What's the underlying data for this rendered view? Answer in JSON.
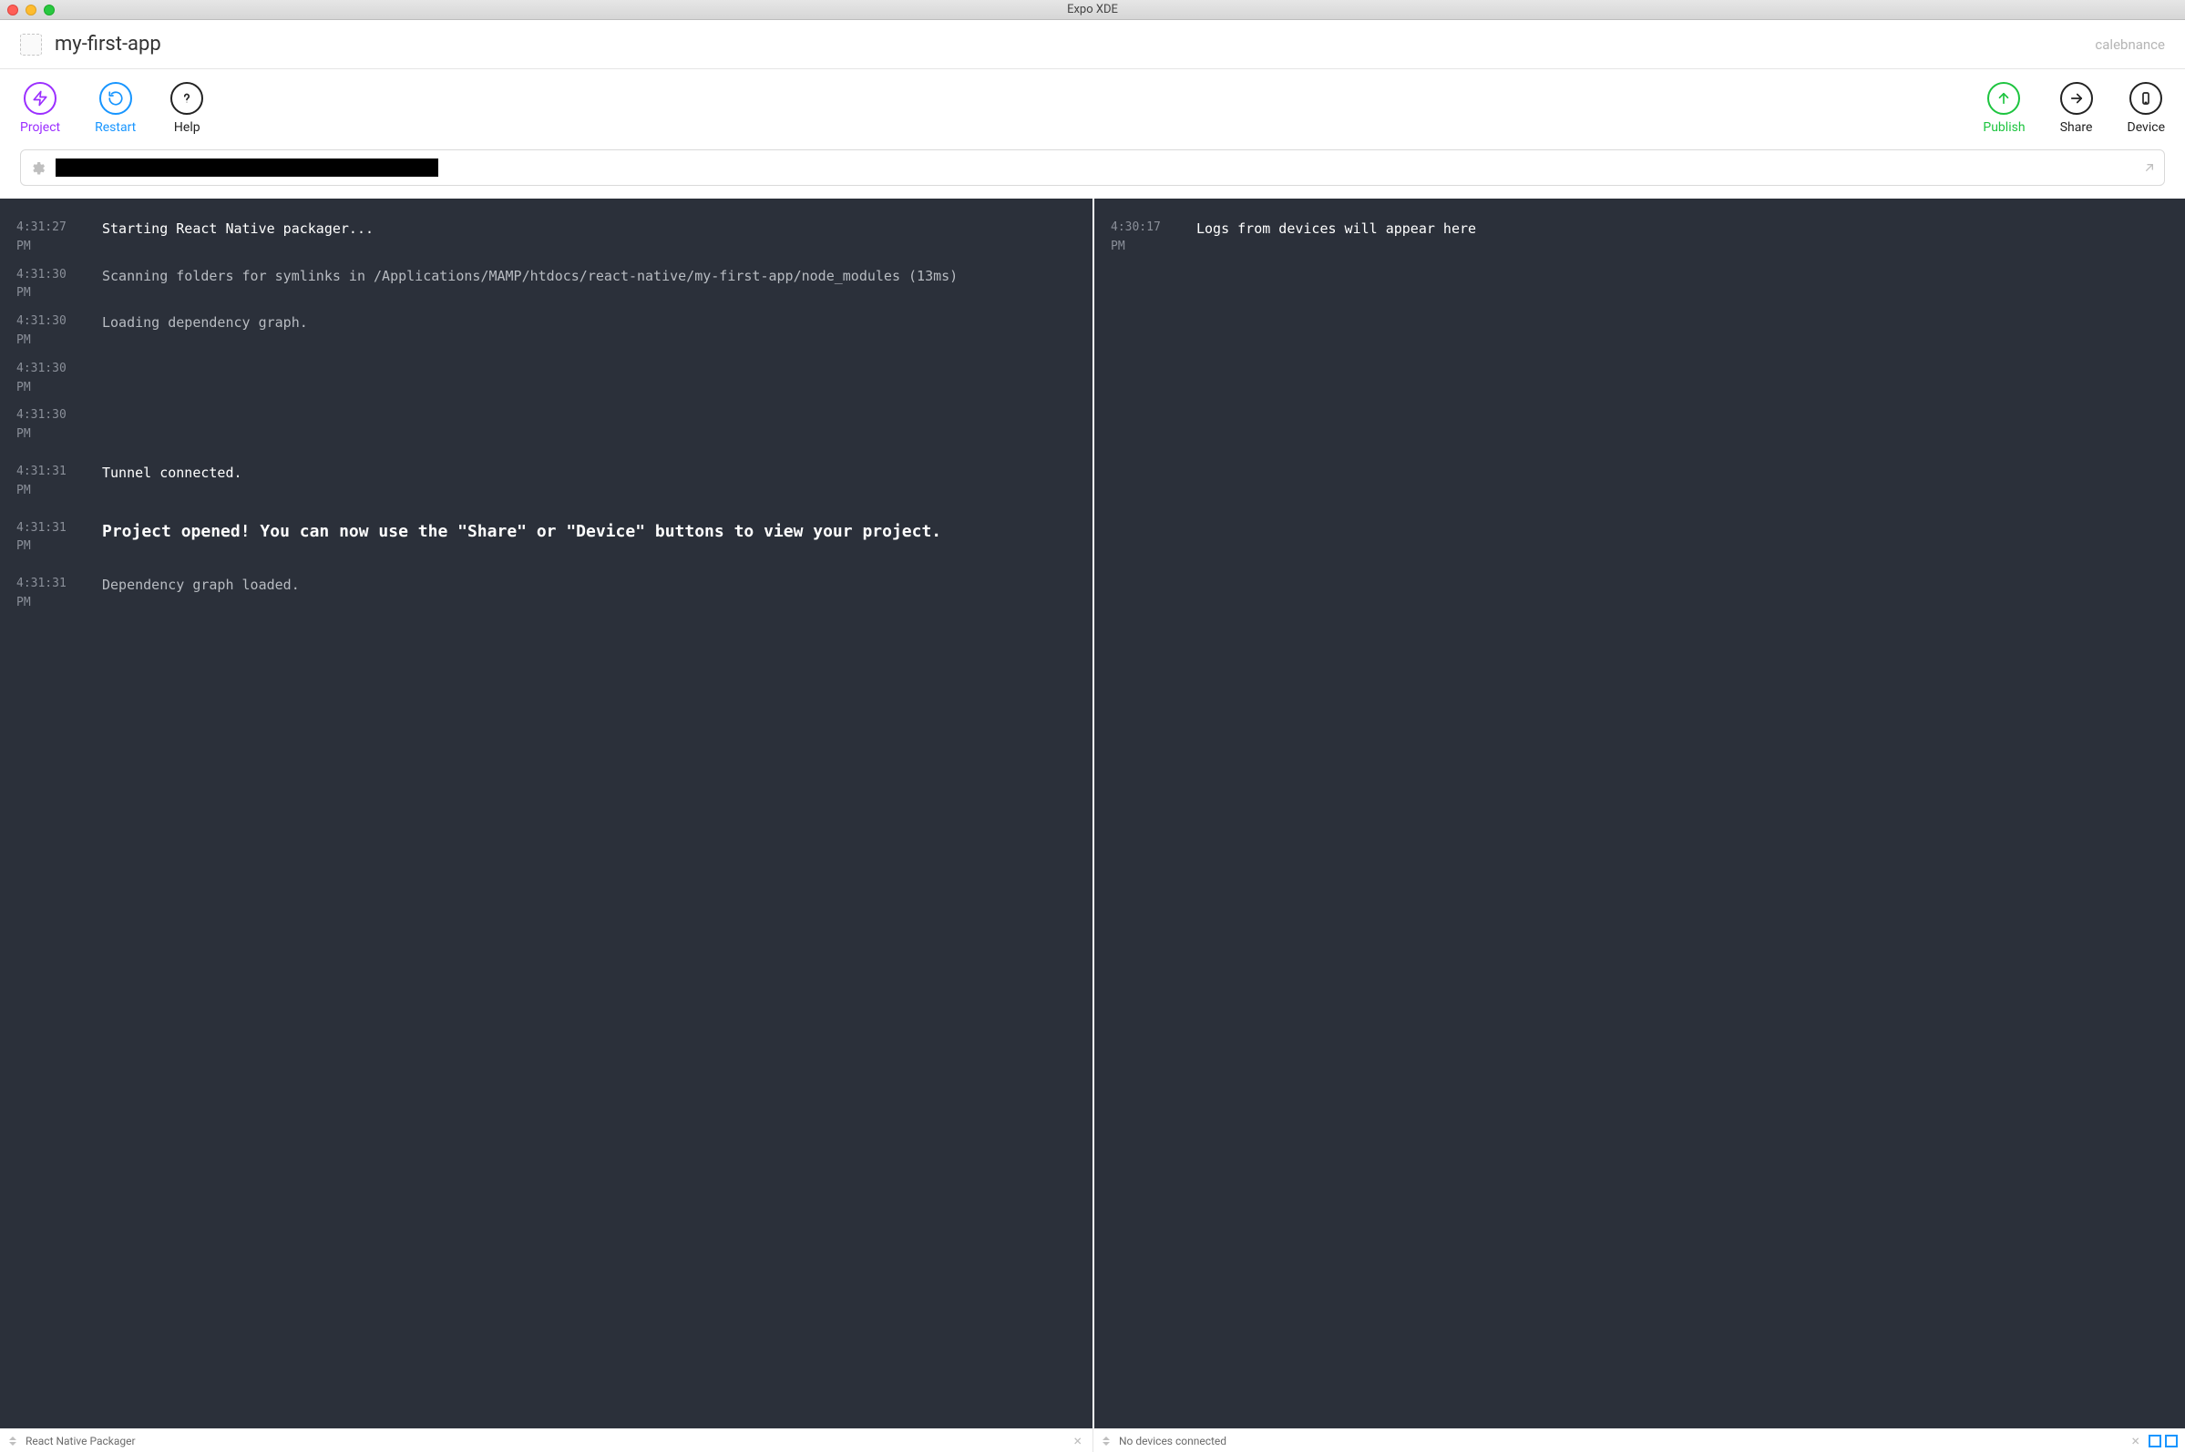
{
  "window": {
    "title": "Expo XDE"
  },
  "header": {
    "project_name": "my-first-app",
    "username": "calebnance"
  },
  "toolbar": {
    "project": "Project",
    "restart": "Restart",
    "help": "Help",
    "publish": "Publish",
    "share": "Share",
    "device": "Device"
  },
  "urlbar": {
    "redacted": true
  },
  "panes": {
    "left": {
      "entries": [
        {
          "ts": "4:31:27 PM",
          "msg": "Starting React Native packager...",
          "style": "bright"
        },
        {
          "ts": "4:31:30 PM",
          "msg": "Scanning folders for symlinks in /Applications/MAMP/htdocs/react-native/my-first-app/node_modules (13ms)",
          "style": "dim"
        },
        {
          "ts": "4:31:30 PM",
          "msg": "Loading dependency graph.",
          "style": "dim"
        },
        {
          "ts": "4:31:30 PM",
          "msg": "",
          "style": "dim"
        },
        {
          "ts": "4:31:30 PM",
          "msg": "",
          "style": "dim"
        },
        {
          "ts": "4:31:31 PM",
          "msg": "Tunnel connected.",
          "style": "bright",
          "gap_before": true
        },
        {
          "ts": "4:31:31 PM",
          "msg": "Project opened! You can now use the \"Share\" or \"Device\" buttons to view your project.",
          "style": "big",
          "gap_before": true
        },
        {
          "ts": "4:31:31 PM",
          "msg": "Dependency graph loaded.",
          "style": "dim",
          "gap_before": true
        }
      ]
    },
    "right": {
      "entries": [
        {
          "ts": "4:30:17 PM",
          "msg": "Logs from devices will appear here",
          "style": "bright"
        }
      ]
    }
  },
  "statusbar": {
    "left_label": "React Native Packager",
    "right_label": "No devices connected"
  }
}
